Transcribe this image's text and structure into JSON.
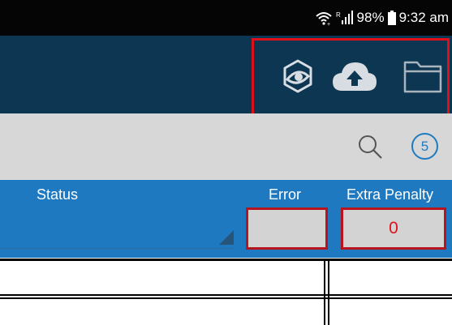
{
  "status_bar": {
    "battery": "98%",
    "time": "9:32 am",
    "icons": [
      "wifi-calling-icon",
      "signal-icon",
      "battery-icon"
    ]
  },
  "toolbar": {
    "icons": [
      "sync-eye-icon",
      "cloud-upload-icon",
      "folder-icon"
    ],
    "highlight_color": "#e0101b"
  },
  "search": {
    "icon": "search-icon",
    "count": "5"
  },
  "table": {
    "columns": [
      "Status",
      "Error",
      "Extra Penalty"
    ],
    "error_value": "",
    "extra_penalty_value": "0"
  },
  "colors": {
    "app_bar": "#0d3653",
    "table_header": "#1e79c1",
    "accent": "#1f7bc1",
    "error_text": "#e0101b"
  }
}
